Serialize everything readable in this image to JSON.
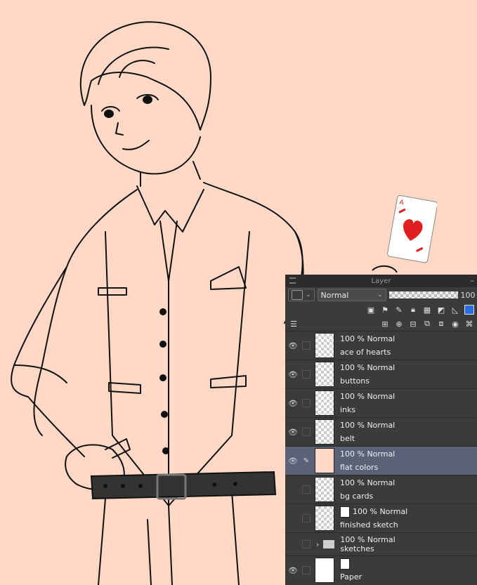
{
  "panel": {
    "title": "Layer",
    "blend_mode": "Normal",
    "opacity_value": "100"
  },
  "layers": [
    {
      "mode": "100 % Normal",
      "name": "ace of hearts"
    },
    {
      "mode": "100 % Normal",
      "name": "buttons"
    },
    {
      "mode": "100 % Normal",
      "name": "inks"
    },
    {
      "mode": "100 % Normal",
      "name": "belt"
    },
    {
      "mode": "100 % Normal",
      "name": "flat colors"
    },
    {
      "mode": "100 % Normal",
      "name": "bg cards"
    },
    {
      "mode": "100 % Normal",
      "name": "finished sketch"
    },
    {
      "mode": "100 % Normal",
      "name": "sketches"
    },
    {
      "mode": "",
      "name": "Paper"
    }
  ],
  "colors": {
    "canvas_bg": "#ffd9c5",
    "panel_bg": "#3b3b3b",
    "selected_row": "#5a6278",
    "card_red": "#e02020"
  },
  "card": {
    "rank": "A"
  }
}
